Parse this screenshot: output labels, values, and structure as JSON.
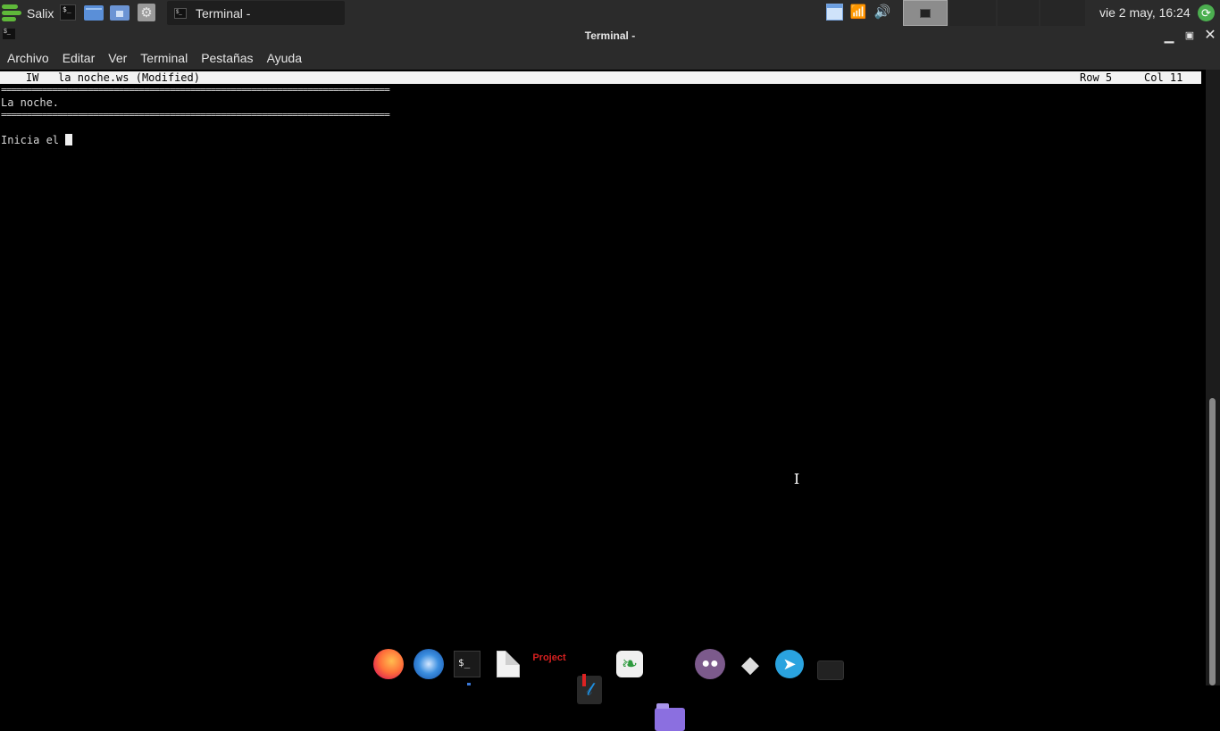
{
  "top_panel": {
    "menu_label": "Salix",
    "launchers": [
      "terminal-icon",
      "file-manager-icon",
      "home-folder-icon",
      "settings-icon"
    ],
    "task_button_label": "Terminal -",
    "tray_icons": [
      "window-icon",
      "wifi-icon",
      "volume-icon"
    ],
    "clock": "vie  2 may, 16:24",
    "update_icon": "update-icon"
  },
  "window": {
    "title": "Terminal -",
    "buttons": [
      "minimize-icon",
      "maximize-icon",
      "close-icon"
    ]
  },
  "menubar": {
    "items": [
      "Archivo",
      "Editar",
      "Ver",
      "Terminal",
      "Pestañas",
      "Ayuda"
    ]
  },
  "editor": {
    "status_left": "    IW   la noche.ws (Modified)",
    "status_row": "Row 5",
    "status_col": "Col 11",
    "lines": [
      "============================================================================",
      "La noche.",
      "============================================================================",
      "",
      "Inicia el "
    ]
  },
  "dock": {
    "items": [
      "firefox-icon",
      "thunderbird-icon",
      "terminal-icon",
      "document-icon",
      "Project",
      "book-icon",
      "leaf-icon",
      "folder-icon",
      "pidgin-icon",
      "inkscape-icon",
      "telegram-icon",
      "keyboard-icon"
    ],
    "terminal_glyph": "$_",
    "project_label": "Project"
  },
  "colors": {
    "panel_bg": "#2b2b2b",
    "terminal_bg": "#000000",
    "status_bar_bg": "#f2f2f2",
    "accent_green": "#5fb83a"
  }
}
